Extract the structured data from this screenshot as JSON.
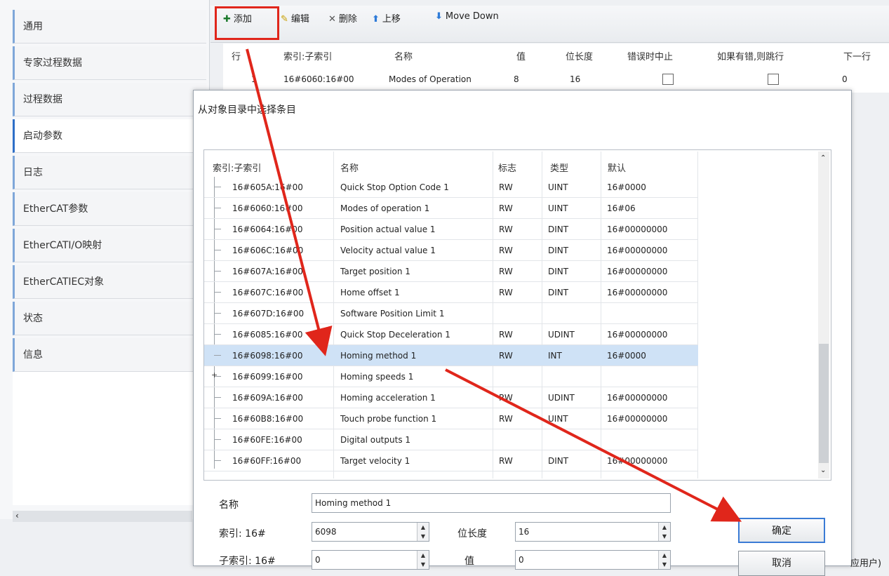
{
  "sidebar": {
    "items": [
      {
        "label": "通用"
      },
      {
        "label": "专家过程数据"
      },
      {
        "label": "过程数据"
      },
      {
        "label": "启动参数"
      },
      {
        "label": "日志"
      },
      {
        "label": "EtherCAT参数"
      },
      {
        "label": "EtherCATI/O映射"
      },
      {
        "label": "EtherCATIEC对象"
      },
      {
        "label": "状态"
      },
      {
        "label": "信息"
      }
    ]
  },
  "toolbar": {
    "add_label": "添加",
    "edit_label": "编辑",
    "delete_label": "删除",
    "move_up_label": "上移",
    "move_down_label": "Move Down"
  },
  "top_table": {
    "headers": [
      "行",
      "索引:子索引",
      "名称",
      "值",
      "位长度",
      "错误时中止",
      "如果有错,则跳行",
      "下一行"
    ],
    "row": {
      "line": "1",
      "index": "16#6060:16#00",
      "name": "Modes of Operation",
      "value": "8",
      "bitlen": "16",
      "next": "0"
    }
  },
  "dialog": {
    "title": "从对象目录中选择条目",
    "headers": [
      "索引:子索引",
      "名称",
      "标志",
      "类型",
      "默认"
    ],
    "rows": [
      {
        "index": "16#605A:16#00",
        "name": "Quick Stop Option Code 1",
        "flag": "RW",
        "type": "UINT",
        "default": "16#0000"
      },
      {
        "index": "16#6060:16#00",
        "name": "Modes of operation 1",
        "flag": "RW",
        "type": "UINT",
        "default": "16#06"
      },
      {
        "index": "16#6064:16#00",
        "name": "Position actual value 1",
        "flag": "RW",
        "type": "DINT",
        "default": "16#00000000"
      },
      {
        "index": "16#606C:16#00",
        "name": "Velocity actual value 1",
        "flag": "RW",
        "type": "DINT",
        "default": "16#00000000"
      },
      {
        "index": "16#607A:16#00",
        "name": "Target position 1",
        "flag": "RW",
        "type": "DINT",
        "default": "16#00000000"
      },
      {
        "index": "16#607C:16#00",
        "name": "Home offset 1",
        "flag": "RW",
        "type": "DINT",
        "default": "16#00000000"
      },
      {
        "index": "16#607D:16#00",
        "name": "Software Position Limit 1",
        "flag": "",
        "type": "",
        "default": ""
      },
      {
        "index": "16#6085:16#00",
        "name": "Quick Stop Deceleration 1",
        "flag": "RW",
        "type": "UDINT",
        "default": "16#00000000"
      },
      {
        "index": "16#6098:16#00",
        "name": "Homing method 1",
        "flag": "RW",
        "type": "INT",
        "default": "16#0000"
      },
      {
        "index": "16#6099:16#00",
        "name": "Homing speeds 1",
        "flag": "",
        "type": "",
        "default": ""
      },
      {
        "index": "16#609A:16#00",
        "name": "Homing acceleration 1",
        "flag": "RW",
        "type": "UDINT",
        "default": "16#00000000"
      },
      {
        "index": "16#60B8:16#00",
        "name": "Touch probe function 1",
        "flag": "RW",
        "type": "UINT",
        "default": "16#00000000"
      },
      {
        "index": "16#60FE:16#00",
        "name": "Digital outputs 1",
        "flag": "",
        "type": "",
        "default": ""
      },
      {
        "index": "16#60FF:16#00",
        "name": "Target velocity 1",
        "flag": "RW",
        "type": "DINT",
        "default": "16#00000000"
      }
    ],
    "name_label": "名称",
    "name_value": "Homing method 1",
    "index_label": "索引: 16#",
    "index_value": "6098",
    "subindex_label": "子索引: 16#",
    "subindex_value": "0",
    "bitlen_label": "位长度",
    "bitlen_value": "16",
    "value_label": "值",
    "value_value": "0",
    "ok_label": "确定",
    "cancel_label": "取消",
    "peek_text": "应用户)"
  },
  "colors": {
    "highlight": "#e0261b",
    "selection": "#cfe2f6",
    "accent": "#2e6fc7"
  }
}
